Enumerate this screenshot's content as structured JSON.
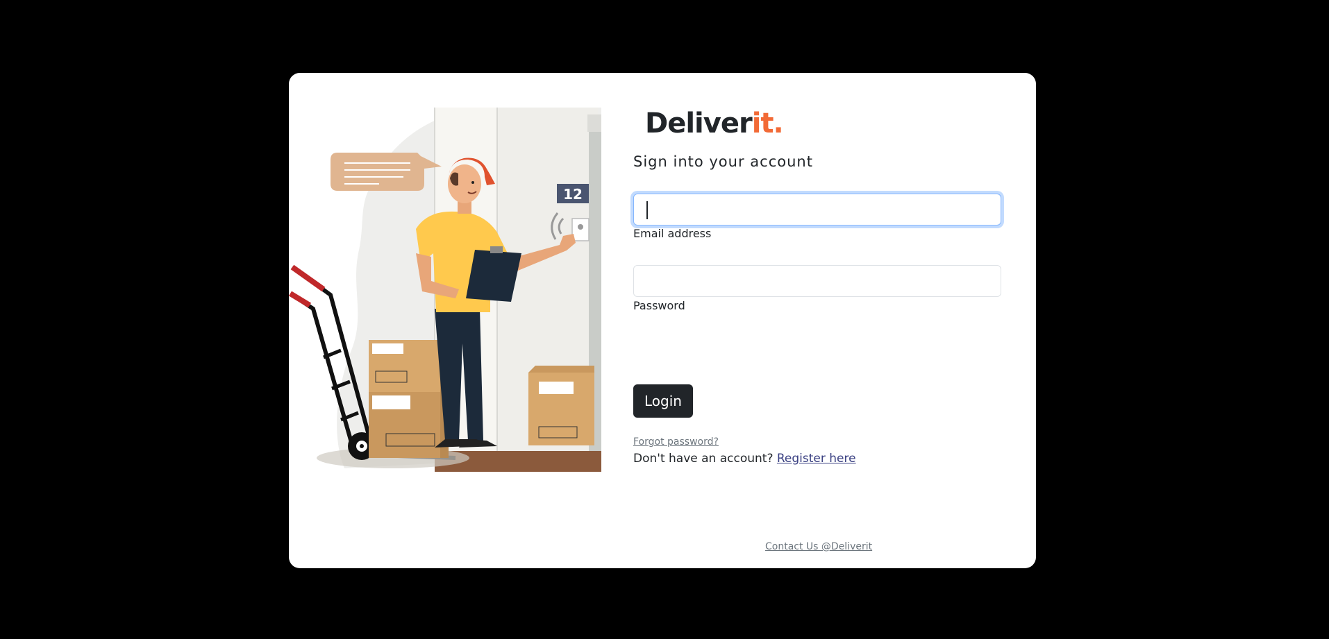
{
  "brand": {
    "name_main": "Deliver",
    "name_accent": "it.",
    "accent_color": "#f26a36",
    "text_color": "#212529"
  },
  "login": {
    "subtitle": "Sign into your account",
    "email_label": "Email address",
    "email_value": "",
    "password_label": "Password",
    "password_value": "",
    "login_button": "Login",
    "forgot_password": "Forgot password?",
    "no_account_text": "Don't have an account?",
    "register_link": "Register here"
  },
  "illustration": {
    "description_icon": "delivery-man-illustration",
    "door_number": "12"
  },
  "footer": {
    "contact": "Contact Us @Deliverit"
  },
  "colors": {
    "page_background": "#000000",
    "card_background": "#ffffff",
    "button_background": "#212529",
    "focus_ring": "#86b7fe"
  }
}
